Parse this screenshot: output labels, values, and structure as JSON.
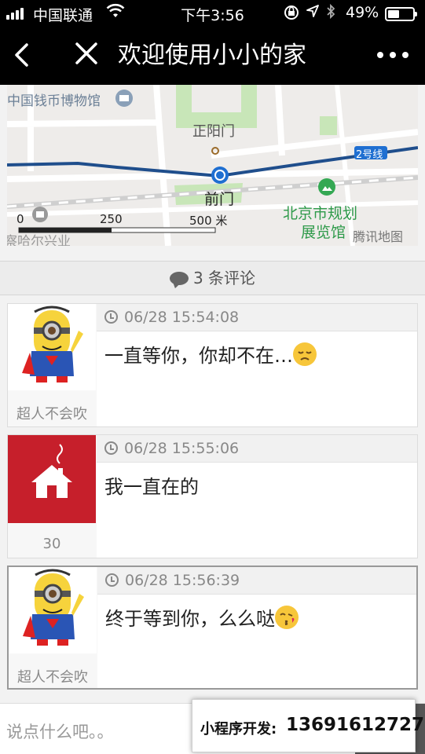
{
  "status_bar": {
    "carrier": "中国联通",
    "time": "下午3:56",
    "battery": "49%"
  },
  "nav": {
    "title": "欢迎使用小小的家"
  },
  "map": {
    "labels": {
      "museum": "中国钱币博物馆",
      "zhengyangmen": "正阳门",
      "line2": "2号线",
      "qianmen": "前门",
      "planning_museum_1": "北京市规划",
      "planning_museum_2": "展览馆",
      "street": "察哈尔兴业",
      "brand": "腾讯地图"
    },
    "scale": {
      "s0": "0",
      "s250": "250",
      "s500": "500 米"
    }
  },
  "comments_header": {
    "count": "3",
    "label": "条评论"
  },
  "comments": [
    {
      "time": "06/28 15:54:08",
      "text": "一直等你，你却不在…",
      "user": "超人不会吹"
    },
    {
      "time": "06/28 15:55:06",
      "text": "我一直在的",
      "user": "30"
    },
    {
      "time": "06/28 15:56:39",
      "text": "终于等到你，么么哒",
      "user": "超人不会吹"
    }
  ],
  "input": {
    "placeholder": "说点什么吧。。"
  },
  "promo": {
    "label": "小程序开发:",
    "phone": "13691612727"
  },
  "colors": {
    "bar": "#000000",
    "house_bg": "#c61f2b",
    "metro_line": "#1f4e8c",
    "park": "#c8e6b8"
  }
}
